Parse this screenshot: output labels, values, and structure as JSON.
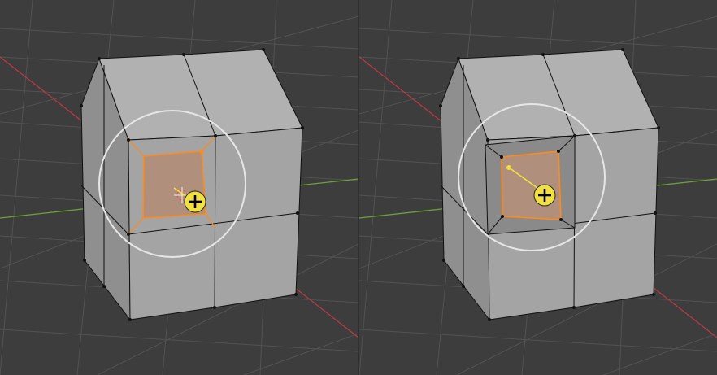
{
  "panels": [
    {
      "id": "left",
      "mode": "face-inset-start"
    },
    {
      "id": "right",
      "mode": "face-inset-result"
    }
  ],
  "colors": {
    "background": "#3d3d3d",
    "grid": "#525252",
    "axis_x": "#b43a44",
    "axis_y": "#6fa13a",
    "face_light": "#a7a7a7",
    "face_mid": "#8f8f8f",
    "face_dark": "#7d7d7d",
    "edge": "#111111",
    "selected_face": "#b0907c",
    "selected_edge": "#ff8a1a",
    "gizmo_ring": "#e6e6e6",
    "cursor_badge": "#f0e040"
  },
  "icons": {
    "transform_cursor": "plus-in-yellow-circle-icon",
    "drag_arrow": "arrow-line-icon"
  }
}
